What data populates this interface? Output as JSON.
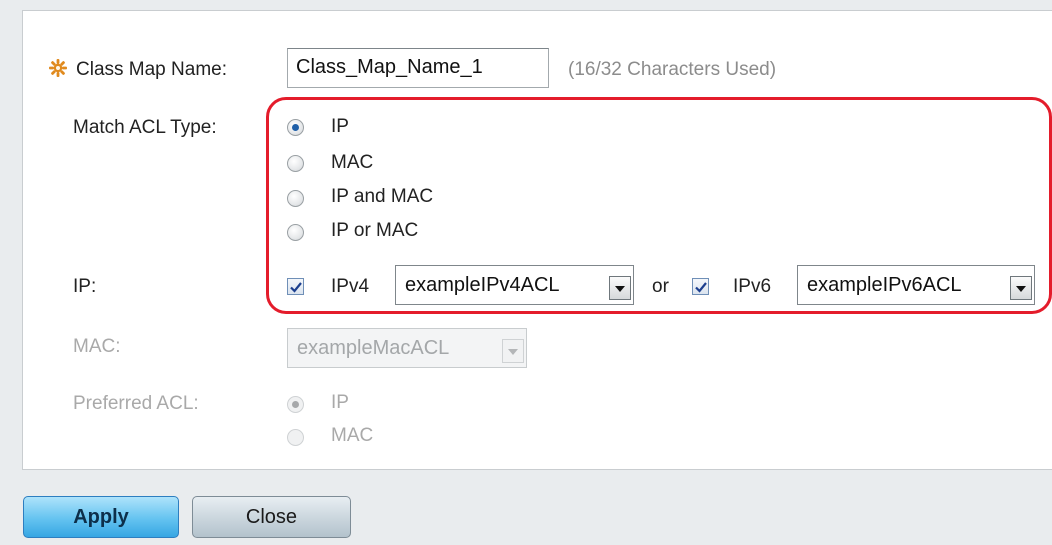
{
  "form": {
    "class_map_name": {
      "label": "Class Map Name:",
      "value": "Class_Map_Name_1",
      "char_hint": "(16/32 Characters Used)"
    },
    "match_acl_type": {
      "label": "Match ACL Type:",
      "options": [
        "IP",
        "MAC",
        "IP and MAC",
        "IP or MAC"
      ],
      "selected": "IP"
    },
    "ip": {
      "label": "IP:",
      "ipv4_label": "IPv4",
      "ipv4_checked": true,
      "ipv4_acl": "exampleIPv4ACL",
      "or_label": "or",
      "ipv6_label": "IPv6",
      "ipv6_checked": true,
      "ipv6_acl": "exampleIPv6ACL"
    },
    "mac": {
      "label": "MAC:",
      "acl": "exampleMacACL",
      "disabled": true
    },
    "preferred_acl": {
      "label": "Preferred ACL:",
      "options": [
        "IP",
        "MAC"
      ],
      "selected": "IP",
      "disabled": true
    }
  },
  "buttons": {
    "apply": "Apply",
    "close": "Close"
  },
  "colors": {
    "highlight": "#e41c2b",
    "required_star": "#e08a1e",
    "apply_button": "#64c3f0"
  },
  "icons": {
    "required": "required-star-icon"
  }
}
